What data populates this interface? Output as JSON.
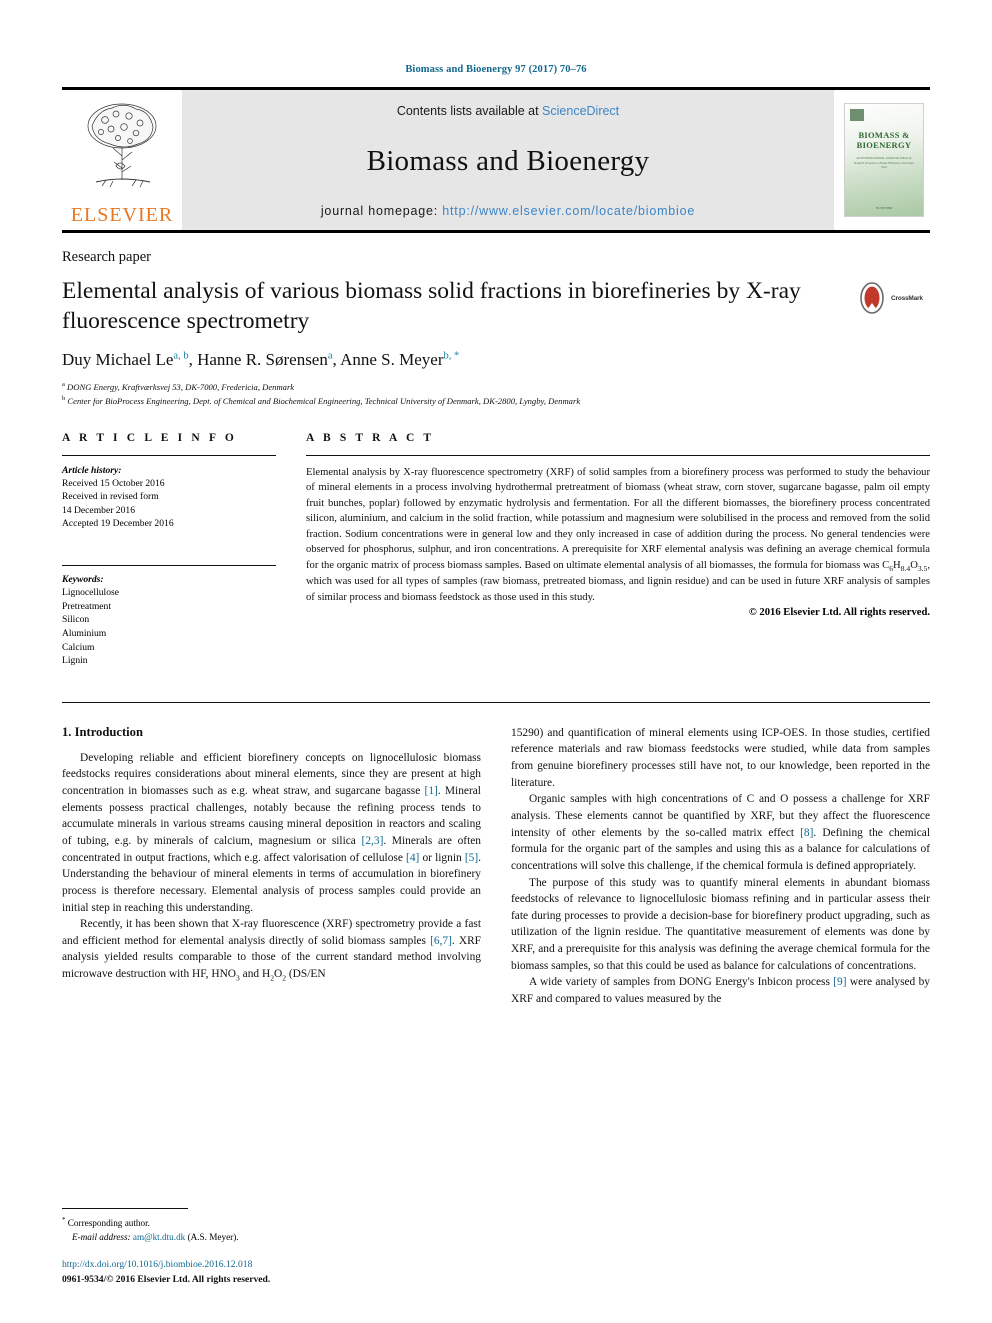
{
  "running_head": "Biomass and Bioenergy 97 (2017) 70–76",
  "masthead": {
    "publisher": "ELSEVIER",
    "contents_prefix": "Contents lists available at ",
    "contents_link": "ScienceDirect",
    "journal_name": "Biomass and Bioenergy",
    "homepage_label": "journal homepage: ",
    "homepage_url": "http://www.elsevier.com/locate/biombioe",
    "cover": {
      "title": "BIOMASS & BIOENERGY",
      "subtitle": "AN INTERNATIONAL JOURNAL\nEdited by Ralph P. Overend, Jo Baier, Efficiency and Clean Tech",
      "footer": "ELSEVIER"
    }
  },
  "article": {
    "type": "Research paper",
    "title": "Elemental analysis of various biomass solid fractions in biorefineries by X-ray fluorescence spectrometry",
    "crossmark_label": "CrossMark",
    "authors_html": "Duy Michael Le <sup>a, b</sup>, Hanne R. Sørensen <sup>a</sup>, Anne S. Meyer <sup>b, *</sup>",
    "affiliations": [
      "DONG Energy, Kraftværksvej 53, DK-7000, Fredericia, Denmark",
      "Center for BioProcess Engineering, Dept. of Chemical and Biochemical Engineering, Technical University of Denmark, DK-2800, Lyngby, Denmark"
    ],
    "affiliation_markers": [
      "a",
      "b"
    ]
  },
  "article_info": {
    "heading": "A R T I C L E   I N F O",
    "history_label": "Article history:",
    "history": [
      "Received 15 October 2016",
      "Received in revised form",
      "14 December 2016",
      "Accepted 19 December 2016"
    ],
    "keywords_label": "Keywords:",
    "keywords": [
      "Lignocellulose",
      "Pretreatment",
      "Silicon",
      "Aluminium",
      "Calcium",
      "Lignin"
    ]
  },
  "abstract": {
    "heading": "A B S T R A C T",
    "text_part1": "Elemental analysis by X-ray fluorescence spectrometry (XRF) of solid samples from a biorefinery process was performed to study the behaviour of mineral elements in a process involving hydrothermal pretreatment of biomass (wheat straw, corn stover, sugarcane bagasse, palm oil empty fruit bunches, poplar) followed by enzymatic hydrolysis and fermentation. For all the different biomasses, the biorefinery process concentrated silicon, aluminium, and calcium in the solid fraction, while potassium and magnesium were solubilised in the process and removed from the solid fraction. Sodium concentrations were in general low and they only increased in case of addition during the process. No general tendencies were observed for phosphorus, sulphur, and iron concentrations. A prerequisite for XRF elemental analysis was defining an average chemical formula for the organic matrix of process biomass samples. Based on ultimate elemental analysis of all biomasses, the formula for biomass was C",
    "formula": {
      "c_sub": "6",
      "h": "H",
      "h_sub": "8.4",
      "o": "O",
      "o_sub": "3.5"
    },
    "text_part2": ", which was used for all types of samples (raw biomass, pretreated biomass, and lignin residue) and can be used in future XRF analysis of samples of similar process and biomass feedstock as those used in this study.",
    "copyright": "© 2016 Elsevier Ltd. All rights reserved."
  },
  "body": {
    "section_heading": "1. Introduction",
    "left_paragraphs": [
      {
        "segments": [
          {
            "t": "Developing reliable and efficient biorefinery concepts on lignocellulosic biomass feedstocks requires considerations about mineral elements, since they are present at high concentration in biomasses such as e.g. wheat straw, and sugarcane bagasse "
          },
          {
            "t": "[1]",
            "ref": true
          },
          {
            "t": ". Mineral elements possess practical challenges, notably because the refining process tends to accumulate minerals in various streams causing mineral deposition in reactors and scaling of tubing, e.g. by minerals of calcium, magnesium or silica "
          },
          {
            "t": "[2,3]",
            "ref": true
          },
          {
            "t": ". Minerals are often concentrated in output fractions, which e.g. affect valorisation of cellulose "
          },
          {
            "t": "[4]",
            "ref": true
          },
          {
            "t": " or lignin "
          },
          {
            "t": "[5]",
            "ref": true
          },
          {
            "t": ". Understanding the behaviour of mineral elements in terms of accumulation in biorefinery process is therefore necessary. Elemental analysis of process samples could provide an initial step in reaching this understanding."
          }
        ]
      },
      {
        "segments": [
          {
            "t": "Recently, it has been shown that X-ray fluorescence (XRF) spectrometry provide a fast and efficient method for elemental analysis directly of solid biomass samples "
          },
          {
            "t": "[6,7]",
            "ref": true
          },
          {
            "t": ". XRF analysis yielded results comparable to those of the current standard method involving microwave destruction with HF, HNO"
          },
          {
            "t": "3",
            "sub": true
          },
          {
            "t": " and H"
          },
          {
            "t": "2",
            "sub": true
          },
          {
            "t": "O"
          },
          {
            "t": "2",
            "sub": true
          },
          {
            "t": " (DS/EN"
          }
        ]
      }
    ],
    "right_paragraphs": [
      {
        "segments": [
          {
            "t": "15290) and quantification of mineral elements using ICP-OES. In those studies, certified reference materials and raw biomass feedstocks were studied, while data from samples from genuine biorefinery processes still have not, to our knowledge, been reported in the literature."
          }
        ],
        "continuation": true
      },
      {
        "segments": [
          {
            "t": "Organic samples with high concentrations of C and O possess a challenge for XRF analysis. These elements cannot be quantified by XRF, but they affect the fluorescence intensity of other elements by the so-called matrix effect "
          },
          {
            "t": "[8]",
            "ref": true
          },
          {
            "t": ". Defining the chemical formula for the organic part of the samples and using this as a balance for calculations of concentrations will solve this challenge, if the chemical formula is defined appropriately."
          }
        ]
      },
      {
        "segments": [
          {
            "t": "The purpose of this study was to quantify mineral elements in abundant biomass feedstocks of relevance to lignocellulosic biomass refining and in particular assess their fate during processes to provide a decision-base for biorefinery product upgrading, such as utilization of the lignin residue. The quantitative measurement of elements was done by XRF, and a prerequisite for this analysis was defining the average chemical formula for the biomass samples, so that this could be used as balance for calculations of concentrations."
          }
        ]
      },
      {
        "segments": [
          {
            "t": "A wide variety of samples from DONG Energy's Inbicon process "
          },
          {
            "t": "[9]",
            "ref": true
          },
          {
            "t": " were analysed by XRF and compared to values measured by the"
          }
        ]
      }
    ]
  },
  "footnote": {
    "corresponding_marker": "*",
    "corresponding_text": "Corresponding author.",
    "email_label": "E-mail address:",
    "email": "am@kt.dtu.dk",
    "email_suffix": "(A.S. Meyer).",
    "doi": "http://dx.doi.org/10.1016/j.biombioe.2016.12.018",
    "issn_line": "0961-9534/© 2016 Elsevier Ltd. All rights reserved."
  },
  "colors": {
    "link": "#12688f",
    "science_direct": "#3d85c6",
    "elsevier_orange": "#e87722",
    "crossmark_red": "#c0392b",
    "masthead_bg": "#e6e6e6"
  }
}
